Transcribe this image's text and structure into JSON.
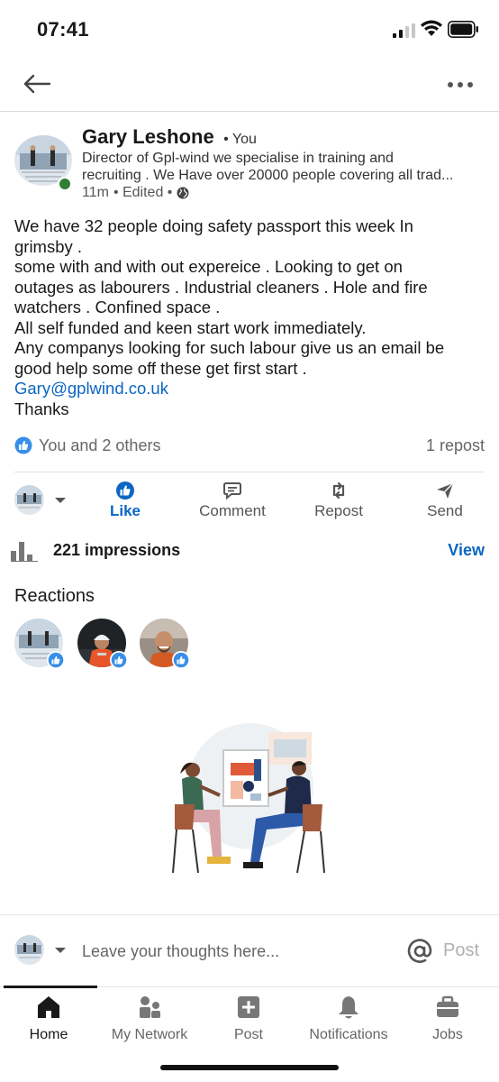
{
  "status_bar": {
    "time": "07:41"
  },
  "post": {
    "author": {
      "name": "Gary Leshone",
      "connection": "• You",
      "headline_line1": "Director of Gpl-wind we specialise in training and",
      "headline_line2": "recruiting . We Have over 20000 people covering all trad...",
      "time": "11m",
      "edited": "• Edited •"
    },
    "body_lines": [
      "We have 32 people doing safety passport this week  In",
      "grimsby .",
      "some with and with out expereice . Looking to get on",
      "outages  as labourers . Industrial cleaners . Hole and fire",
      "watchers . Confined space .",
      "All self funded and keen start work immediately.",
      "Any companys looking for such labour give us an email be",
      "good help some off these get first start ."
    ],
    "email": "Gary@gplwind.co.uk",
    "closing": "Thanks",
    "reactions_summary": "You and 2 others",
    "reposts": "1 repost"
  },
  "actions": {
    "like": "Like",
    "comment": "Comment",
    "repost": "Repost",
    "send": "Send"
  },
  "analytics": {
    "impressions": "221 impressions",
    "view": "View"
  },
  "reactions": {
    "heading": "Reactions",
    "reactors": [
      "author",
      "reactor-2",
      "reactor-3"
    ]
  },
  "composer": {
    "placeholder": "Leave your thoughts here...",
    "post_label": "Post"
  },
  "tabs": [
    {
      "label": "Home",
      "icon": "home-icon"
    },
    {
      "label": "My Network",
      "icon": "network-icon"
    },
    {
      "label": "Post",
      "icon": "plus-box-icon"
    },
    {
      "label": "Notifications",
      "icon": "bell-icon"
    },
    {
      "label": "Jobs",
      "icon": "briefcase-icon"
    }
  ],
  "colors": {
    "accent": "#0a66c2",
    "online": "#2e7d32",
    "text": "#191919",
    "muted": "#666666"
  }
}
